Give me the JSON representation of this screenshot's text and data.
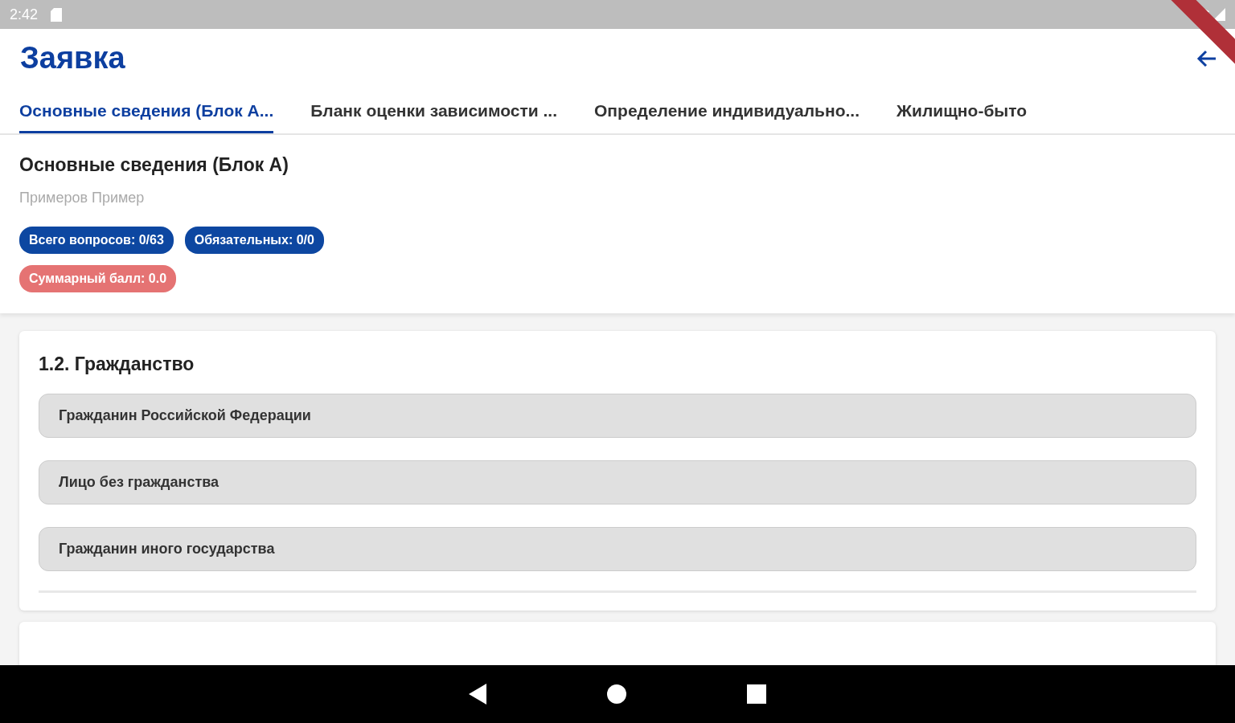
{
  "status_bar": {
    "time": "2:42"
  },
  "app_bar": {
    "title": "Заявка"
  },
  "tabs": [
    {
      "label": "Основные сведения (Блок А...",
      "selected": true
    },
    {
      "label": "Бланк оценки зависимости ...",
      "selected": false
    },
    {
      "label": "Определение индивидуально...",
      "selected": false
    },
    {
      "label": "Жилищно-быто",
      "selected": false
    }
  ],
  "section": {
    "title": "Основные сведения (Блок А)",
    "subtitle": "Примеров Пример",
    "badges": [
      {
        "text": "Всего вопросов: 0/63",
        "color": "#0d47a1"
      },
      {
        "text": "Обязательных: 0/0",
        "color": "#0d47a1"
      },
      {
        "text": "Суммарный балл: 0.0",
        "color": "#e57373"
      }
    ]
  },
  "question": {
    "title": "1.2. Гражданство",
    "options": [
      "Гражданин Российской Федерации",
      "Лицо без гражданства",
      "Гражданин иного государства"
    ]
  }
}
